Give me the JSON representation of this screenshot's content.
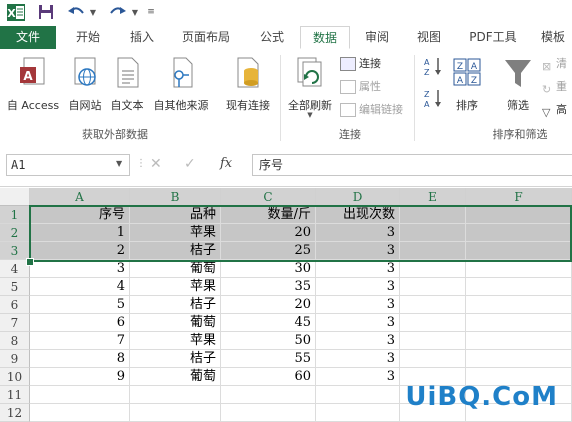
{
  "tabs": [
    "文件",
    "开始",
    "插入",
    "页面布局",
    "公式",
    "数据",
    "审阅",
    "视图",
    "PDF工具",
    "模板"
  ],
  "active_tab": "数据",
  "ribbon": {
    "get_external": {
      "group_label": "获取外部数据",
      "buttons": [
        "自 Access",
        "自网站",
        "自文本",
        "自其他来源"
      ]
    },
    "existing_connections": "现有连接",
    "connections": {
      "group_label": "连接",
      "refresh_all": "全部刷新",
      "connections": "连接",
      "properties": "属性",
      "edit_links": "编辑链接"
    },
    "sort_filter": {
      "group_label": "排序和筛选",
      "sort": "排序",
      "filter": "筛选",
      "clear": "清",
      "reapply": "重",
      "advanced": "高"
    }
  },
  "formula_bar": {
    "name_box": "A1",
    "fx": "fx",
    "content": "序号"
  },
  "columns": [
    "A",
    "B",
    "C",
    "D",
    "E",
    "F"
  ],
  "rows": [
    [
      "序号",
      "品种",
      "数量/斤",
      "出现次数"
    ],
    [
      "1",
      "苹果",
      "20",
      "3"
    ],
    [
      "2",
      "桔子",
      "25",
      "3"
    ],
    [
      "3",
      "葡萄",
      "30",
      "3"
    ],
    [
      "4",
      "苹果",
      "35",
      "3"
    ],
    [
      "5",
      "桔子",
      "20",
      "3"
    ],
    [
      "6",
      "葡萄",
      "45",
      "3"
    ],
    [
      "7",
      "苹果",
      "50",
      "3"
    ],
    [
      "8",
      "桔子",
      "55",
      "3"
    ],
    [
      "9",
      "葡萄",
      "60",
      "3"
    ],
    [
      "",
      "",
      "",
      ""
    ],
    [
      "",
      "",
      "",
      ""
    ]
  ],
  "row_numbers": [
    "1",
    "2",
    "3",
    "4",
    "5",
    "6",
    "7",
    "8",
    "9",
    "10",
    "11",
    "12"
  ],
  "watermark": "UiBQ.CoM",
  "colors": {
    "accent": "#217346",
    "selection": "#c6c6c6",
    "watermark": "#1f80c8"
  }
}
